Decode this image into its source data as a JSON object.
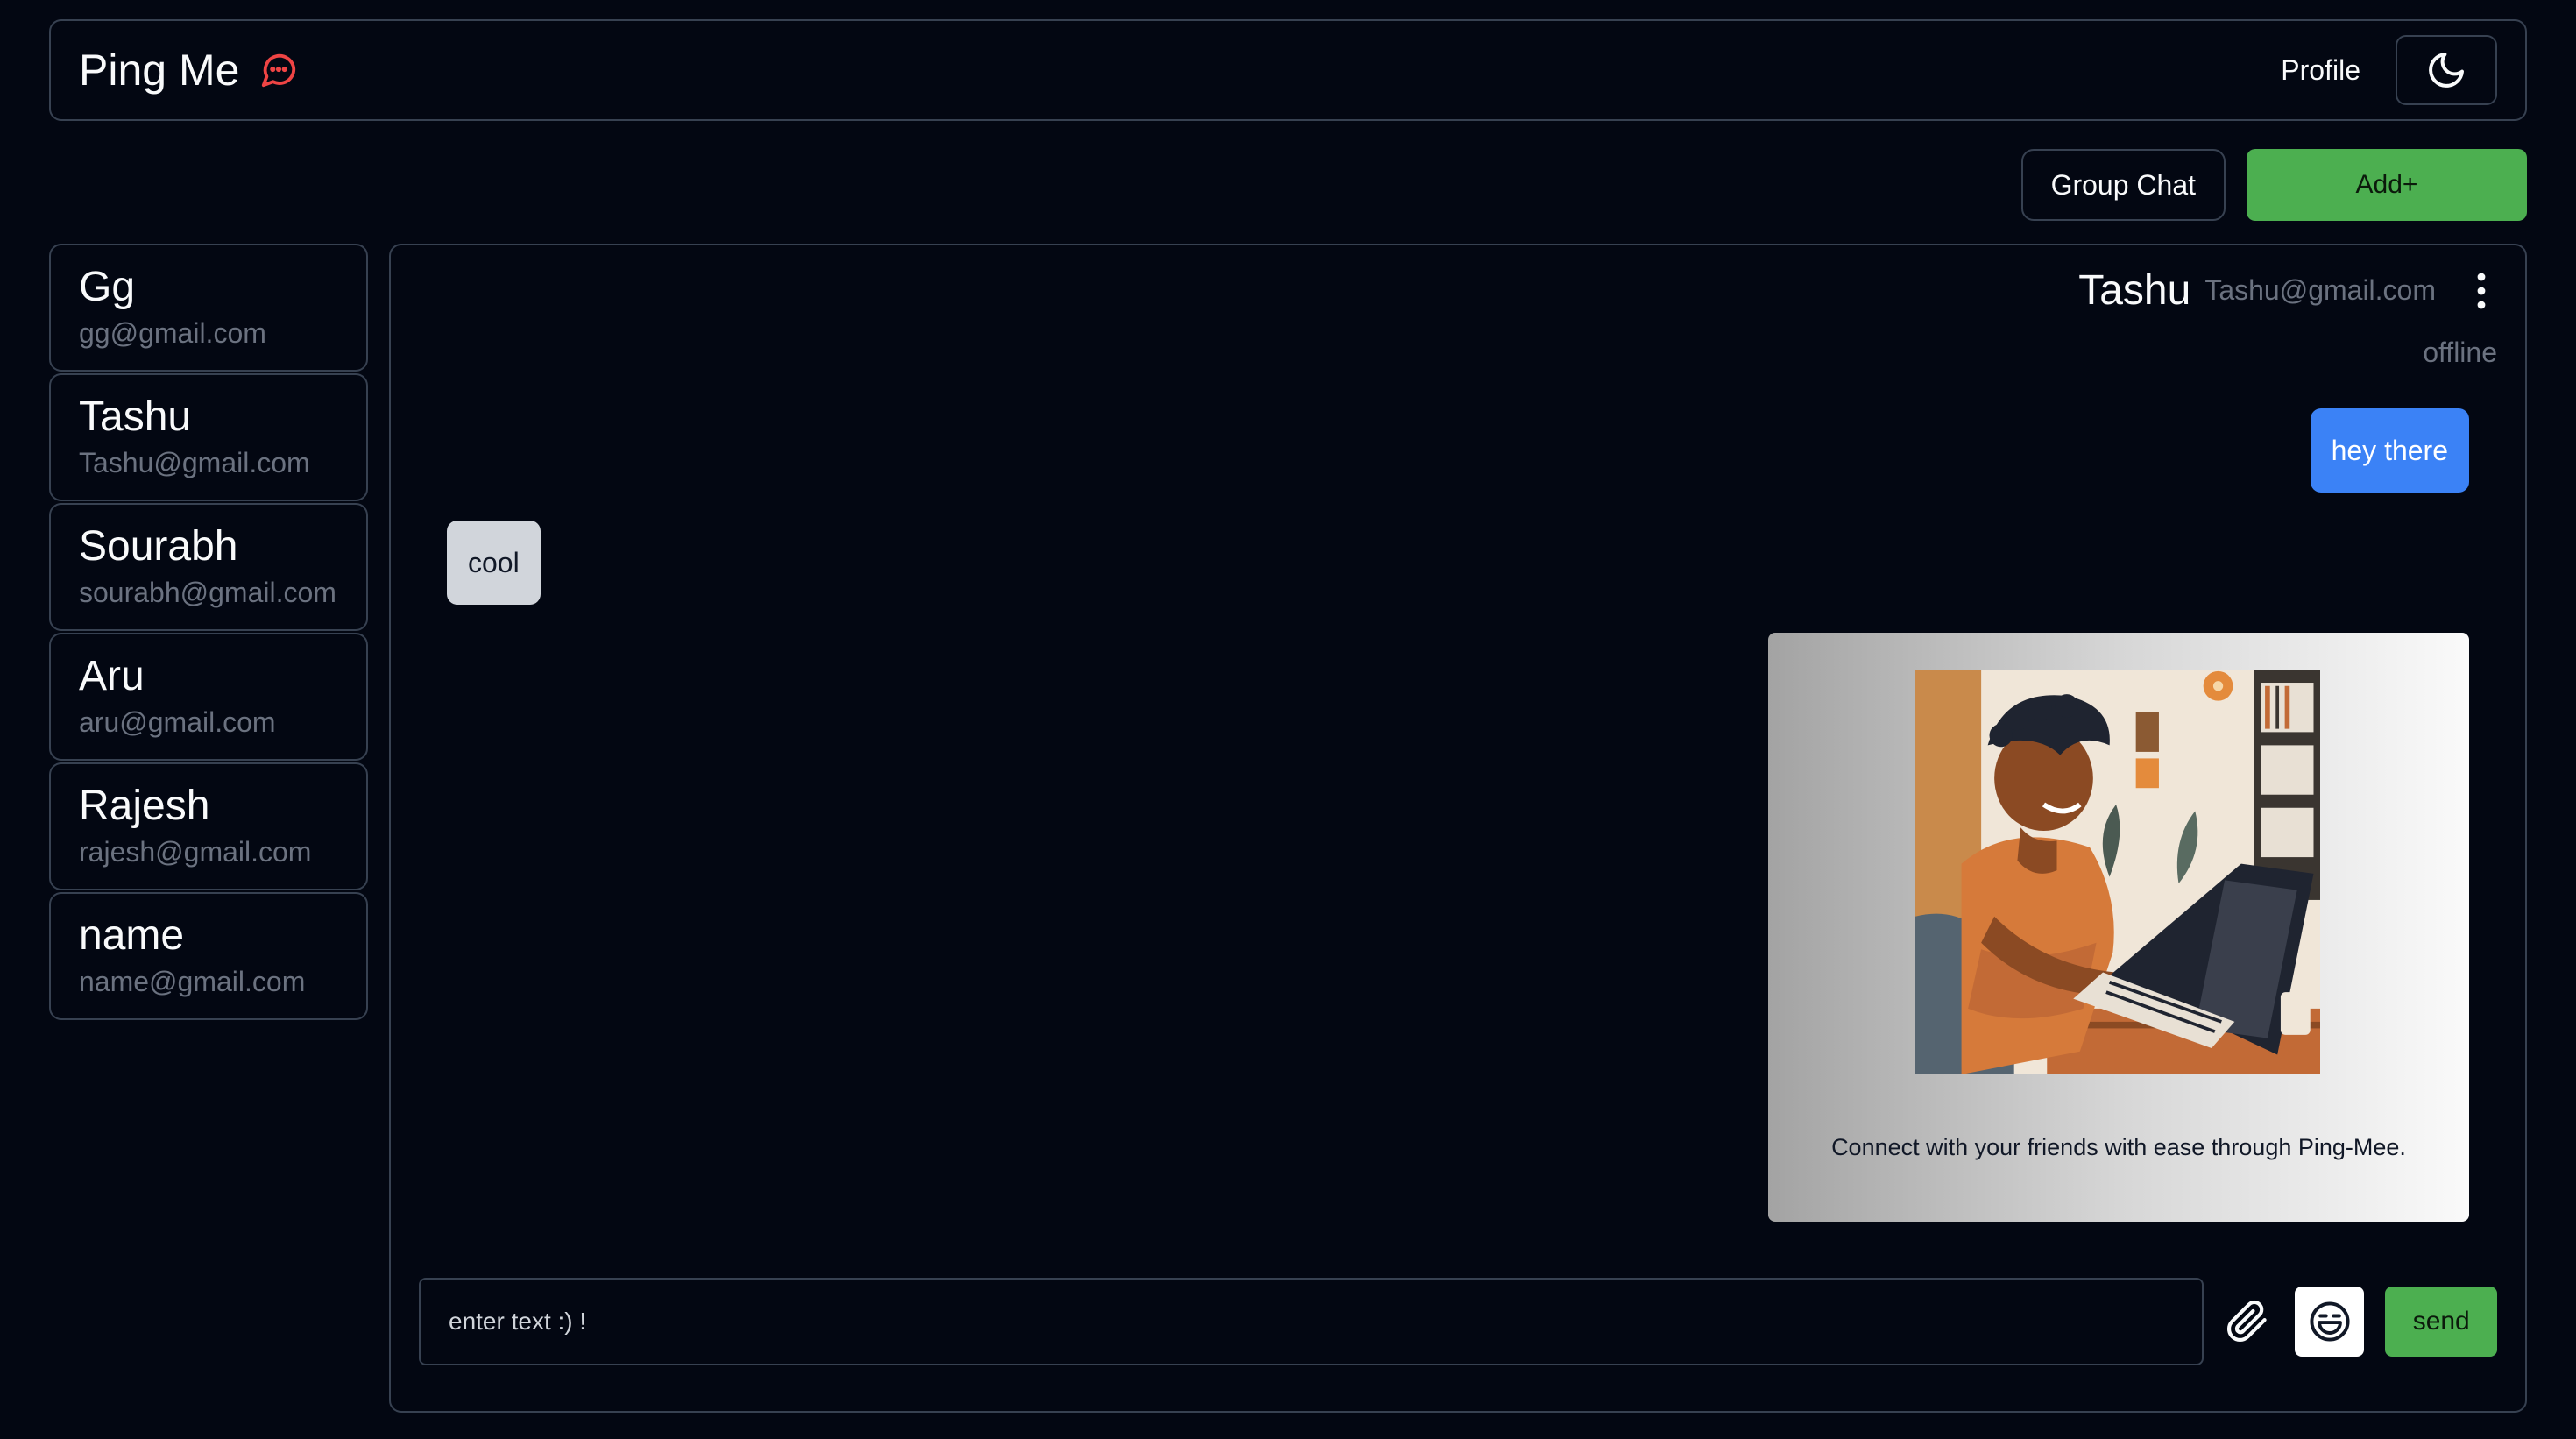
{
  "header": {
    "app_name": "Ping Me",
    "logo_icon": "chat-bubble-icon",
    "profile_label": "Profile",
    "theme_icon": "moon-icon"
  },
  "actions": {
    "group_chat_label": "Group Chat",
    "add_label": "Add+"
  },
  "sidebar": {
    "contacts": [
      {
        "name": "Gg",
        "email": "gg@gmail.com"
      },
      {
        "name": "Tashu",
        "email": "Tashu@gmail.com"
      },
      {
        "name": "Sourabh",
        "email": "sourabh@gmail.com"
      },
      {
        "name": "Aru",
        "email": "aru@gmail.com"
      },
      {
        "name": "Rajesh",
        "email": "rajesh@gmail.com"
      },
      {
        "name": "name",
        "email": "name@gmail.com"
      }
    ]
  },
  "chat": {
    "user_name": "Tashu",
    "user_email": "Tashu@gmail.com",
    "status": "offline",
    "menu_icon": "kebab-menu-icon",
    "messages": [
      {
        "direction": "outgoing",
        "type": "text",
        "text": "hey there"
      },
      {
        "direction": "incoming",
        "type": "text",
        "text": "cool"
      },
      {
        "direction": "outgoing",
        "type": "image",
        "caption": "Connect with your friends with ease through Ping-Mee."
      }
    ]
  },
  "composer": {
    "placeholder": "enter text :) !",
    "value": "",
    "attach_icon": "paperclip-icon",
    "emoji_icon": "emoji-icon",
    "send_label": "send"
  },
  "colors": {
    "background": "#030712",
    "border": "#374151",
    "accent_green": "#4caf50",
    "bubble_blue": "#3b82f6",
    "bubble_gray": "#d1d5db",
    "logo_red": "#ef4444"
  }
}
